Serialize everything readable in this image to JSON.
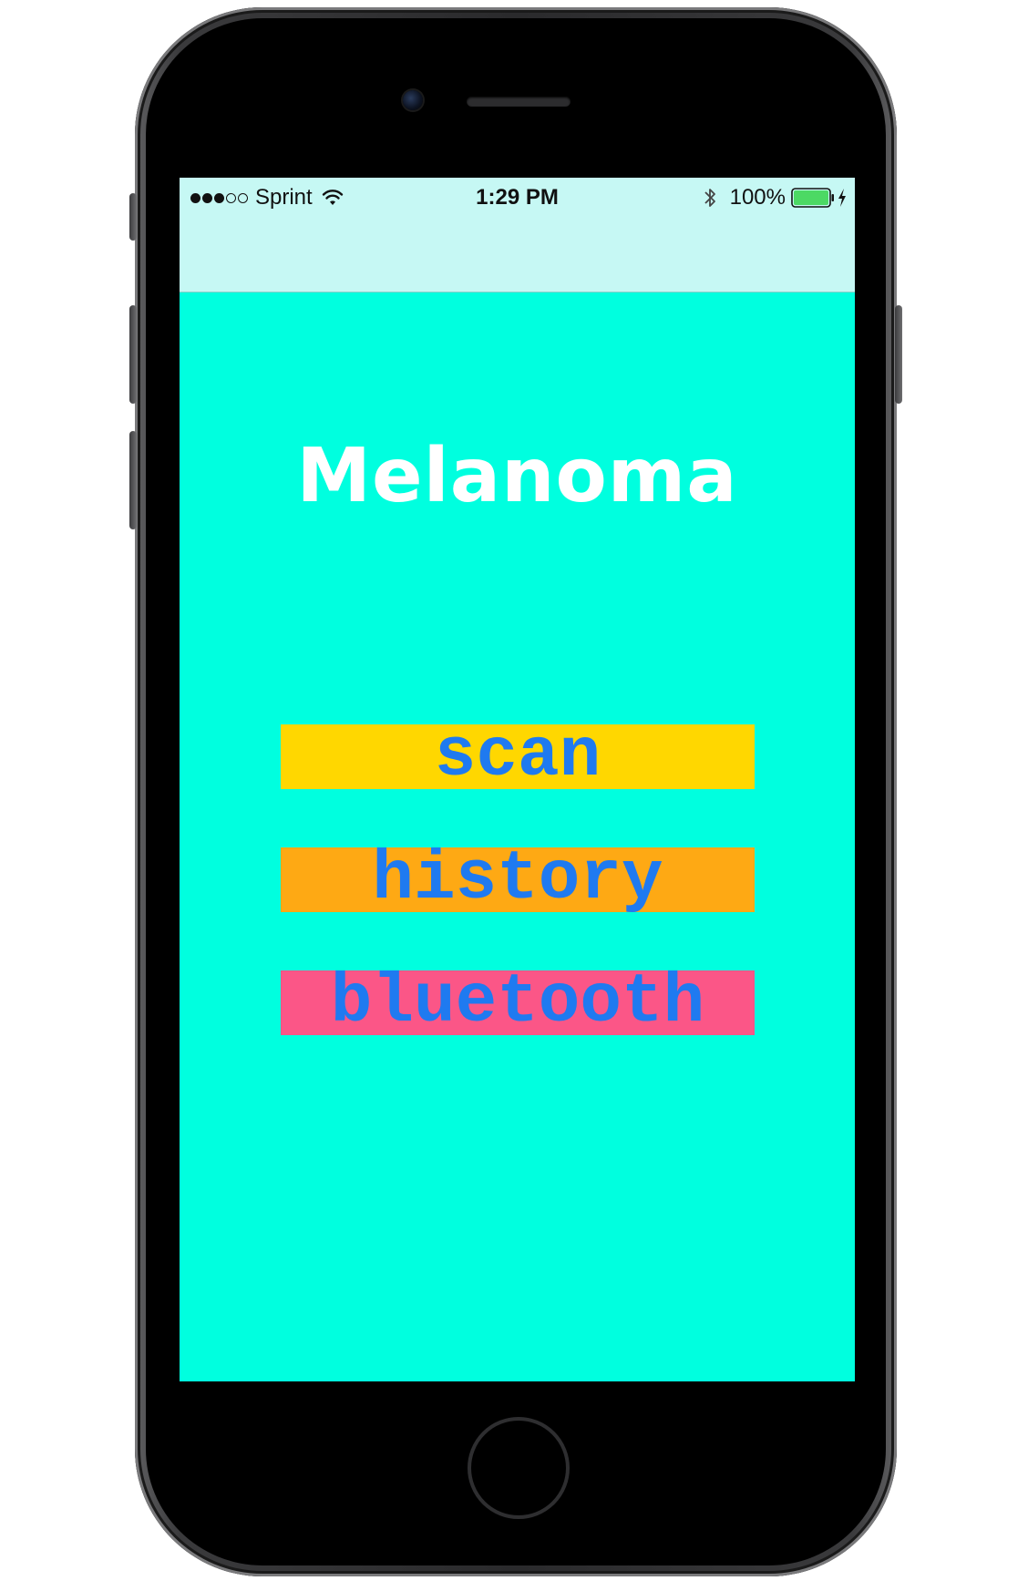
{
  "status_bar": {
    "carrier": "Sprint",
    "signal_bars_filled": 3,
    "signal_bars_total": 5,
    "time": "1:29 PM",
    "battery_percent_text": "100%",
    "battery_level": 1.0,
    "icons": {
      "wifi": "wifi-icon",
      "bluetooth": "bluetooth-icon",
      "battery": "battery-icon",
      "charging": "charging-bolt-icon"
    }
  },
  "app": {
    "title": "Melanoma",
    "buttons": [
      {
        "label": "scan",
        "color": "#ffd700"
      },
      {
        "label": "history",
        "color": "#fea914"
      },
      {
        "label": "bluetooth",
        "color": "#fb5687"
      }
    ],
    "button_text_color": "#1f7af0",
    "background_color": "#00ffdf",
    "nav_bar_color": "#c6f8f4"
  },
  "device": {
    "frame_color": "#2a2a2c",
    "battery_fill_color": "#4cd964"
  }
}
